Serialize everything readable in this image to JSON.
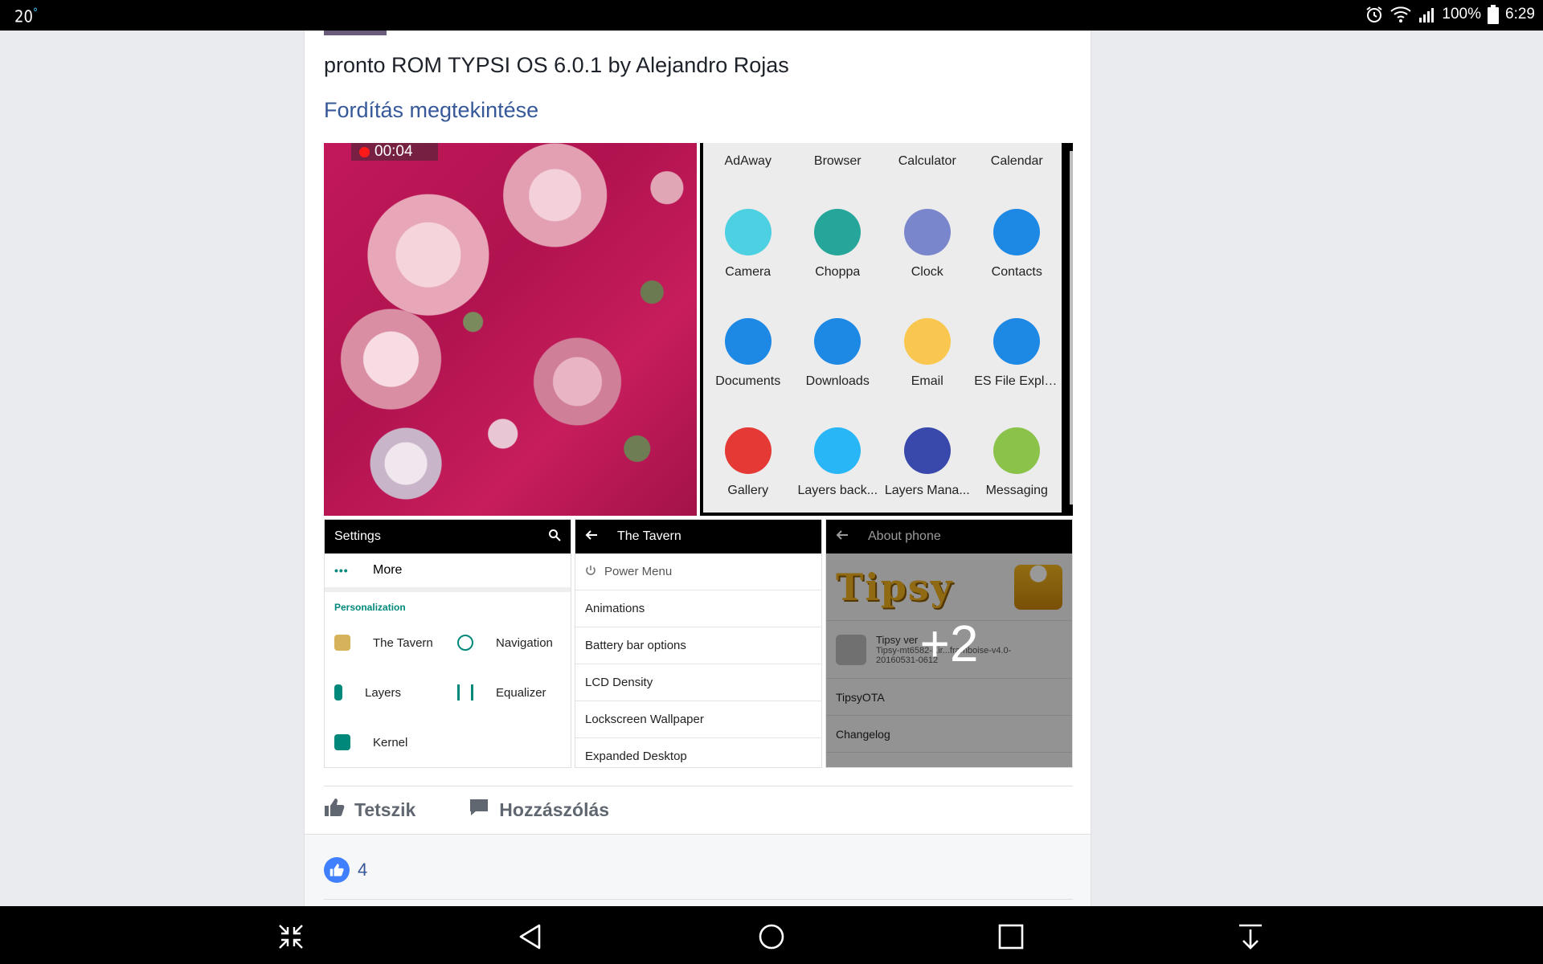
{
  "status_bar": {
    "temperature": "20",
    "temperature_unit": "°",
    "battery_percent": "100%",
    "time": "6:29",
    "icons": [
      "alarm-icon",
      "wifi-icon",
      "signal-icon",
      "battery-icon"
    ]
  },
  "post": {
    "text": "pronto ROM TYPSI OS 6.0.1 by Alejandro Rojas",
    "translate_link": "Fordítás megtekintése"
  },
  "media": {
    "video_timer": "00:04",
    "app_drawer": {
      "top_row": [
        "AdAway",
        "Browser",
        "Calculator",
        "Calendar"
      ],
      "apps": [
        {
          "label": "Camera",
          "color": "#4dd0e1"
        },
        {
          "label": "Choppa",
          "color": "#26a69a"
        },
        {
          "label": "Clock",
          "color": "#7986cb"
        },
        {
          "label": "Contacts",
          "color": "#1e88e5"
        },
        {
          "label": "Documents",
          "color": "#1e88e5"
        },
        {
          "label": "Downloads",
          "color": "#1e88e5"
        },
        {
          "label": "Email",
          "color": "#f9c74f"
        },
        {
          "label": "ES File Explo...",
          "color": "#1e88e5"
        },
        {
          "label": "Gallery",
          "color": "#e53935"
        },
        {
          "label": "Layers back...",
          "color": "#29b6f6"
        },
        {
          "label": "Layers Mana...",
          "color": "#3949ab"
        },
        {
          "label": "Messaging",
          "color": "#8bc34a"
        }
      ]
    },
    "settings": {
      "title": "Settings",
      "more_label": "More",
      "section": "Personalization",
      "items": [
        "The Tavern",
        "Navigation",
        "Layers",
        "Equalizer",
        "Kernel"
      ]
    },
    "tavern": {
      "title": "The Tavern",
      "rows": [
        "Power Menu",
        "Animations",
        "Battery bar options",
        "LCD Density",
        "Lockscreen Wallpaper",
        "Expanded Desktop"
      ]
    },
    "about": {
      "title": "About phone",
      "logo_text": "Tipsy",
      "version_label": "Tipsy ver",
      "version_value": "Tipsy-mt6582-Kir...framboise-v4.0-20160531-0612",
      "rows": [
        "TipsyOTA",
        "Changelog"
      ],
      "more_count": "+2"
    }
  },
  "actions": {
    "like": "Tetszik",
    "comment": "Hozzászólás"
  },
  "reactions": {
    "like_count": "4"
  },
  "colors": {
    "link": "#365899",
    "like_bubble": "#4080ff",
    "rec_dot": "#ff1a1a"
  }
}
